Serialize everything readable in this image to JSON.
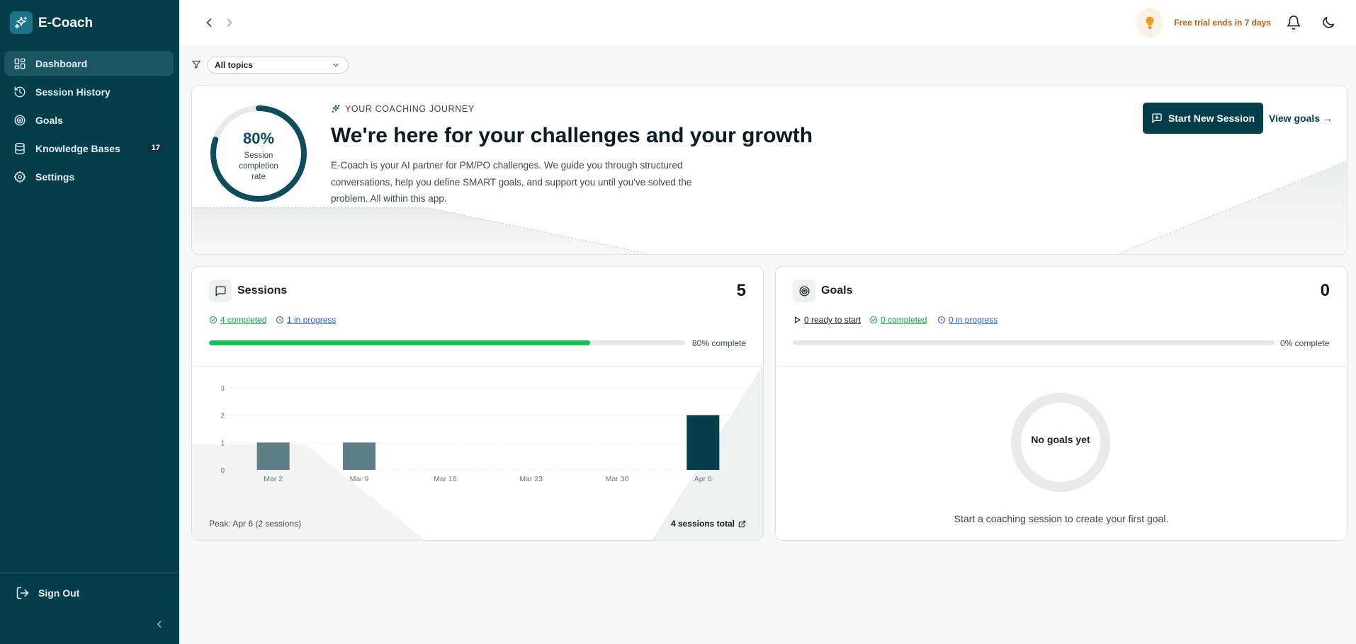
{
  "app": {
    "name": "E-Coach"
  },
  "sidebar": {
    "items": [
      {
        "label": "Dashboard",
        "icon": "dashboard-icon",
        "active": true
      },
      {
        "label": "Session History",
        "icon": "history-icon"
      },
      {
        "label": "Goals",
        "icon": "target-icon"
      },
      {
        "label": "Knowledge Bases",
        "icon": "database-icon",
        "badge": "17"
      },
      {
        "label": "Settings",
        "icon": "gear-icon"
      }
    ],
    "sign_out": "Sign Out"
  },
  "topbar": {
    "trial_text": "Free trial ends in 7 days"
  },
  "filter": {
    "selected": "All topics"
  },
  "hero": {
    "completion_pct": "80%",
    "completion_value": 0.8,
    "completion_label": "Session completion rate",
    "eyebrow": "YOUR COACHING JOURNEY",
    "title": "We're here for your challenges and your growth",
    "description": "E-Coach is your AI partner for PM/PO challenges. We guide you through structured conversations, help you define SMART goals, and support you until you've solved the problem. All within this app.",
    "start_button": "Start New Session",
    "view_goals": "View goals →"
  },
  "sessions": {
    "title": "Sessions",
    "count": "5",
    "completed": "4 completed",
    "in_progress": "1 in progress",
    "progress_value": 0.8,
    "progress_label": "80% complete",
    "peak": "Peak: Apr 6 (2 sessions)",
    "total": "4 sessions total"
  },
  "goals": {
    "title": "Goals",
    "count": "0",
    "ready": "0 ready to start",
    "completed": "0 completed",
    "in_progress": "0 in progress",
    "progress_value": 0,
    "progress_label": "0% complete",
    "ring_text": "No goals yet",
    "empty_text": "Start a coaching session to create your first goal."
  },
  "colors": {
    "primary": "#053e4b",
    "accent_green": "#14c253",
    "accent_blue": "#2563eb",
    "trial_orange": "#b85e10"
  },
  "chart_data": {
    "type": "bar",
    "categories": [
      "Mar 2",
      "Mar 9",
      "Mar 16",
      "Mar 23",
      "Mar 30",
      "Apr 6"
    ],
    "values": [
      1,
      1,
      0,
      0,
      0,
      2
    ],
    "ylim": [
      0,
      3
    ],
    "yticks": [
      0,
      1,
      2,
      3
    ],
    "grid": true
  }
}
